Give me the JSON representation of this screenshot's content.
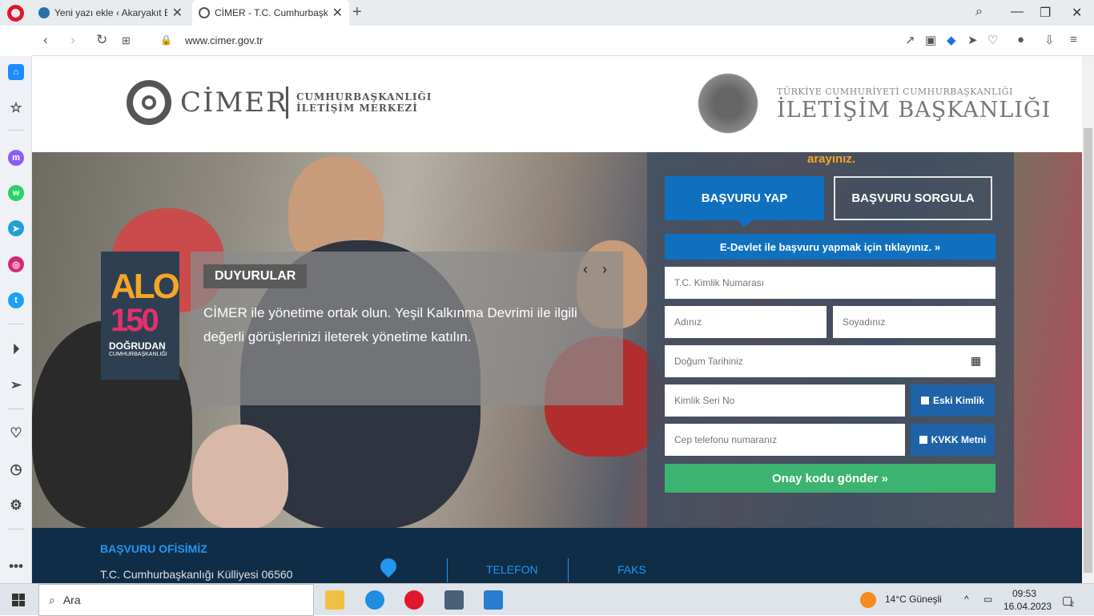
{
  "browser": {
    "tabs": [
      {
        "title": "Yeni yazı ekle ‹ Akaryakıt Be",
        "favicon": "wordpress-icon",
        "close": "✕"
      },
      {
        "title": "CİMER - T.C. Cumhurbaşkanlığ",
        "favicon": "globe-icon",
        "close": "✕"
      }
    ],
    "new_tab": "+",
    "url": "www.cimer.gov.tr"
  },
  "sidebar": {
    "items": [
      "home-icon",
      "star-icon",
      "messenger-icon",
      "whatsapp-icon",
      "telegram-icon",
      "instagram-icon",
      "twitter-icon",
      "player-icon",
      "send-icon",
      "heart-icon",
      "history-icon",
      "settings-icon",
      "more-icon"
    ],
    "more": "•••"
  },
  "header": {
    "cimer_name": "CİMER",
    "cimer_sub1": "CUMHURBAŞKANLIĞI",
    "cimer_sub2": "İLETİŞİM MERKEZİ",
    "ib_sub": "TÜRKİYE CUMHURİYETİ CUMHURBAŞKANLIĞI",
    "ib_name": "İLETİŞİM BAŞKANLIĞI"
  },
  "alo": {
    "n1": "ALO",
    "n2": "150",
    "line1": "DOĞRUDAN",
    "line2": "CUMHURBAŞKANLIĞI"
  },
  "announcement": {
    "badge": "DUYURULAR",
    "text": "CİMER ile yönetime ortak olun. Yeşil Kalkınma Devrimi ile ilgili değerli görüşlerinizi ileterek yönetime katılın.",
    "prev": "‹",
    "next": "›"
  },
  "form": {
    "hint": "arayınız.",
    "tab_apply": "BAŞVURU YAP",
    "tab_query": "BAŞVURU SORGULA",
    "edevlet": "E-Devlet ile başvuru yapmak için tıklayınız. »",
    "tc_placeholder": "T.C. Kimlik Numarası",
    "name_placeholder": "Adınız",
    "surname_placeholder": "Soyadınız",
    "birth_placeholder": "Doğum Tarihiniz",
    "serial_placeholder": "Kimlik Seri No",
    "old_id": "Eski Kimlik",
    "phone_placeholder": "Cep telefonu numaranız",
    "kvkk": "KVKK Metni",
    "submit": "Onay kodu gönder »"
  },
  "footer": {
    "office_title": "BAŞVURU OFİSİMİZ",
    "address": "T.C. Cumhurbaşkanlığı Külliyesi 06560",
    "phone": "TELEFON",
    "fax": "FAKS"
  },
  "taskbar": {
    "search": "Ara",
    "weather": "14°C  Güneşli",
    "time": "09:53",
    "date": "16.04.2023",
    "notifications": "2"
  },
  "colors": {
    "brand_blue": "#0f70c0",
    "green": "#3cb371",
    "orange": "#f5a623",
    "footer": "#102d47"
  }
}
